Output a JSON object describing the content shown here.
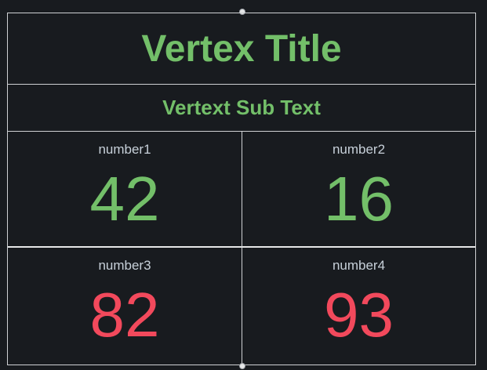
{
  "panel": {
    "title": "Vertex Title",
    "subtitle": "Vertext Sub Text",
    "metrics": [
      {
        "label": "number1",
        "value": "42",
        "status": "ok"
      },
      {
        "label": "number2",
        "value": "16",
        "status": "ok"
      },
      {
        "label": "number3",
        "value": "82",
        "status": "alert"
      },
      {
        "label": "number4",
        "value": "93",
        "status": "alert"
      }
    ]
  },
  "colors": {
    "background": "#181b1f",
    "ok": "#73bf69",
    "alert": "#f2495c",
    "label": "#c7d0d9",
    "border": "#cfd1d4"
  }
}
